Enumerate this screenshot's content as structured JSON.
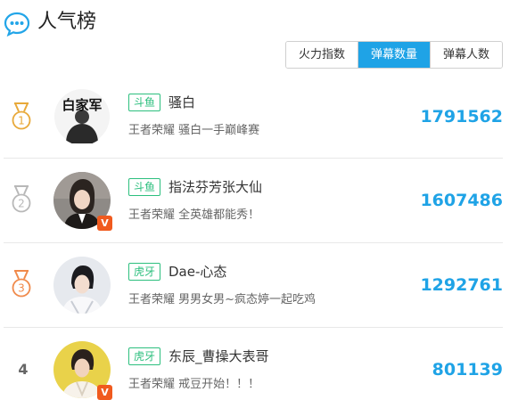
{
  "header": {
    "title": "人气榜",
    "icon": "chat-bubble-icon"
  },
  "tabs": [
    {
      "label": "火力指数",
      "active": false
    },
    {
      "label": "弹幕数量",
      "active": true
    },
    {
      "label": "弹幕人数",
      "active": false
    }
  ],
  "ranking": [
    {
      "rank": "1",
      "platform": "斗鱼",
      "name": "骚白",
      "game": "王者荣耀",
      "tagline": "骚白一手巅峰赛",
      "count": "1791562",
      "verified": false
    },
    {
      "rank": "2",
      "platform": "斗鱼",
      "name": "指法芬芳张大仙",
      "game": "王者荣耀",
      "tagline": "全英雄都能秀！",
      "count": "1607486",
      "verified": true
    },
    {
      "rank": "3",
      "platform": "虎牙",
      "name": "Dae-心态",
      "game": "王者荣耀",
      "tagline": "男男女男~疯态婷一起吃鸡",
      "count": "1292761",
      "verified": false
    },
    {
      "rank": "4",
      "platform": "虎牙",
      "name": "东辰_曹操大表哥",
      "game": "王者荣耀",
      "tagline": "戒豆开始！！！",
      "count": "801139",
      "verified": true
    }
  ],
  "badges": {
    "verified_label": "V"
  },
  "avatar1_logo_text": "白家军",
  "colors": {
    "accent": "#1fa3e6",
    "platform_green": "#2cbf7e",
    "gold": "#e8a93a",
    "silver": "#b8b8b8",
    "bronze": "#f08a4b",
    "verified_orange": "#f05a1e"
  }
}
